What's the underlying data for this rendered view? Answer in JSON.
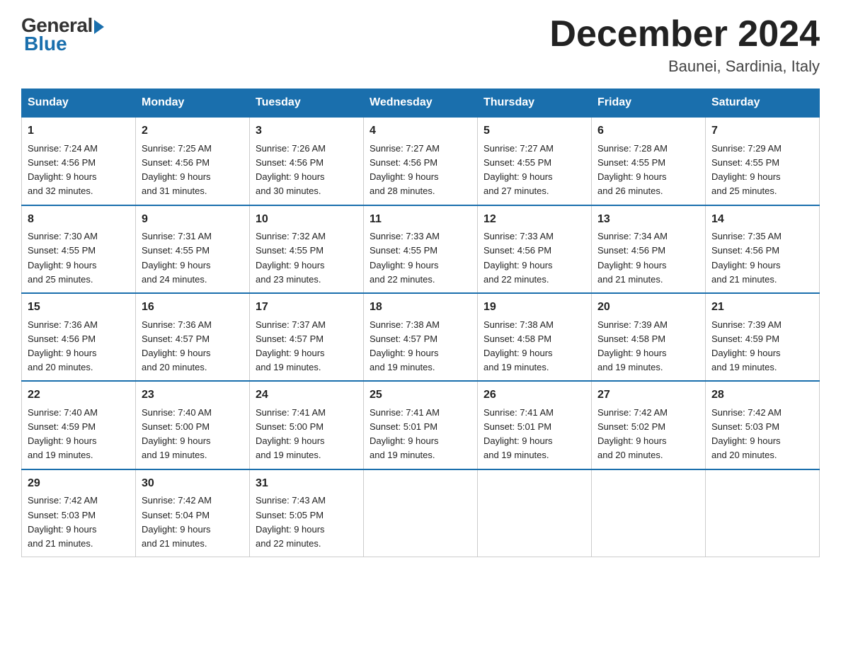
{
  "logo": {
    "general": "General",
    "blue": "Blue",
    "underline": "Blue"
  },
  "header": {
    "title": "December 2024",
    "location": "Baunei, Sardinia, Italy"
  },
  "days_of_week": [
    "Sunday",
    "Monday",
    "Tuesday",
    "Wednesday",
    "Thursday",
    "Friday",
    "Saturday"
  ],
  "weeks": [
    [
      {
        "day": "1",
        "sunrise": "7:24 AM",
        "sunset": "4:56 PM",
        "daylight": "9 hours and 32 minutes."
      },
      {
        "day": "2",
        "sunrise": "7:25 AM",
        "sunset": "4:56 PM",
        "daylight": "9 hours and 31 minutes."
      },
      {
        "day": "3",
        "sunrise": "7:26 AM",
        "sunset": "4:56 PM",
        "daylight": "9 hours and 30 minutes."
      },
      {
        "day": "4",
        "sunrise": "7:27 AM",
        "sunset": "4:56 PM",
        "daylight": "9 hours and 28 minutes."
      },
      {
        "day": "5",
        "sunrise": "7:27 AM",
        "sunset": "4:55 PM",
        "daylight": "9 hours and 27 minutes."
      },
      {
        "day": "6",
        "sunrise": "7:28 AM",
        "sunset": "4:55 PM",
        "daylight": "9 hours and 26 minutes."
      },
      {
        "day": "7",
        "sunrise": "7:29 AM",
        "sunset": "4:55 PM",
        "daylight": "9 hours and 25 minutes."
      }
    ],
    [
      {
        "day": "8",
        "sunrise": "7:30 AM",
        "sunset": "4:55 PM",
        "daylight": "9 hours and 25 minutes."
      },
      {
        "day": "9",
        "sunrise": "7:31 AM",
        "sunset": "4:55 PM",
        "daylight": "9 hours and 24 minutes."
      },
      {
        "day": "10",
        "sunrise": "7:32 AM",
        "sunset": "4:55 PM",
        "daylight": "9 hours and 23 minutes."
      },
      {
        "day": "11",
        "sunrise": "7:33 AM",
        "sunset": "4:55 PM",
        "daylight": "9 hours and 22 minutes."
      },
      {
        "day": "12",
        "sunrise": "7:33 AM",
        "sunset": "4:56 PM",
        "daylight": "9 hours and 22 minutes."
      },
      {
        "day": "13",
        "sunrise": "7:34 AM",
        "sunset": "4:56 PM",
        "daylight": "9 hours and 21 minutes."
      },
      {
        "day": "14",
        "sunrise": "7:35 AM",
        "sunset": "4:56 PM",
        "daylight": "9 hours and 21 minutes."
      }
    ],
    [
      {
        "day": "15",
        "sunrise": "7:36 AM",
        "sunset": "4:56 PM",
        "daylight": "9 hours and 20 minutes."
      },
      {
        "day": "16",
        "sunrise": "7:36 AM",
        "sunset": "4:57 PM",
        "daylight": "9 hours and 20 minutes."
      },
      {
        "day": "17",
        "sunrise": "7:37 AM",
        "sunset": "4:57 PM",
        "daylight": "9 hours and 19 minutes."
      },
      {
        "day": "18",
        "sunrise": "7:38 AM",
        "sunset": "4:57 PM",
        "daylight": "9 hours and 19 minutes."
      },
      {
        "day": "19",
        "sunrise": "7:38 AM",
        "sunset": "4:58 PM",
        "daylight": "9 hours and 19 minutes."
      },
      {
        "day": "20",
        "sunrise": "7:39 AM",
        "sunset": "4:58 PM",
        "daylight": "9 hours and 19 minutes."
      },
      {
        "day": "21",
        "sunrise": "7:39 AM",
        "sunset": "4:59 PM",
        "daylight": "9 hours and 19 minutes."
      }
    ],
    [
      {
        "day": "22",
        "sunrise": "7:40 AM",
        "sunset": "4:59 PM",
        "daylight": "9 hours and 19 minutes."
      },
      {
        "day": "23",
        "sunrise": "7:40 AM",
        "sunset": "5:00 PM",
        "daylight": "9 hours and 19 minutes."
      },
      {
        "day": "24",
        "sunrise": "7:41 AM",
        "sunset": "5:00 PM",
        "daylight": "9 hours and 19 minutes."
      },
      {
        "day": "25",
        "sunrise": "7:41 AM",
        "sunset": "5:01 PM",
        "daylight": "9 hours and 19 minutes."
      },
      {
        "day": "26",
        "sunrise": "7:41 AM",
        "sunset": "5:01 PM",
        "daylight": "9 hours and 19 minutes."
      },
      {
        "day": "27",
        "sunrise": "7:42 AM",
        "sunset": "5:02 PM",
        "daylight": "9 hours and 20 minutes."
      },
      {
        "day": "28",
        "sunrise": "7:42 AM",
        "sunset": "5:03 PM",
        "daylight": "9 hours and 20 minutes."
      }
    ],
    [
      {
        "day": "29",
        "sunrise": "7:42 AM",
        "sunset": "5:03 PM",
        "daylight": "9 hours and 21 minutes."
      },
      {
        "day": "30",
        "sunrise": "7:42 AM",
        "sunset": "5:04 PM",
        "daylight": "9 hours and 21 minutes."
      },
      {
        "day": "31",
        "sunrise": "7:43 AM",
        "sunset": "5:05 PM",
        "daylight": "9 hours and 22 minutes."
      },
      null,
      null,
      null,
      null
    ]
  ],
  "labels": {
    "sunrise": "Sunrise:",
    "sunset": "Sunset:",
    "daylight": "Daylight:"
  }
}
